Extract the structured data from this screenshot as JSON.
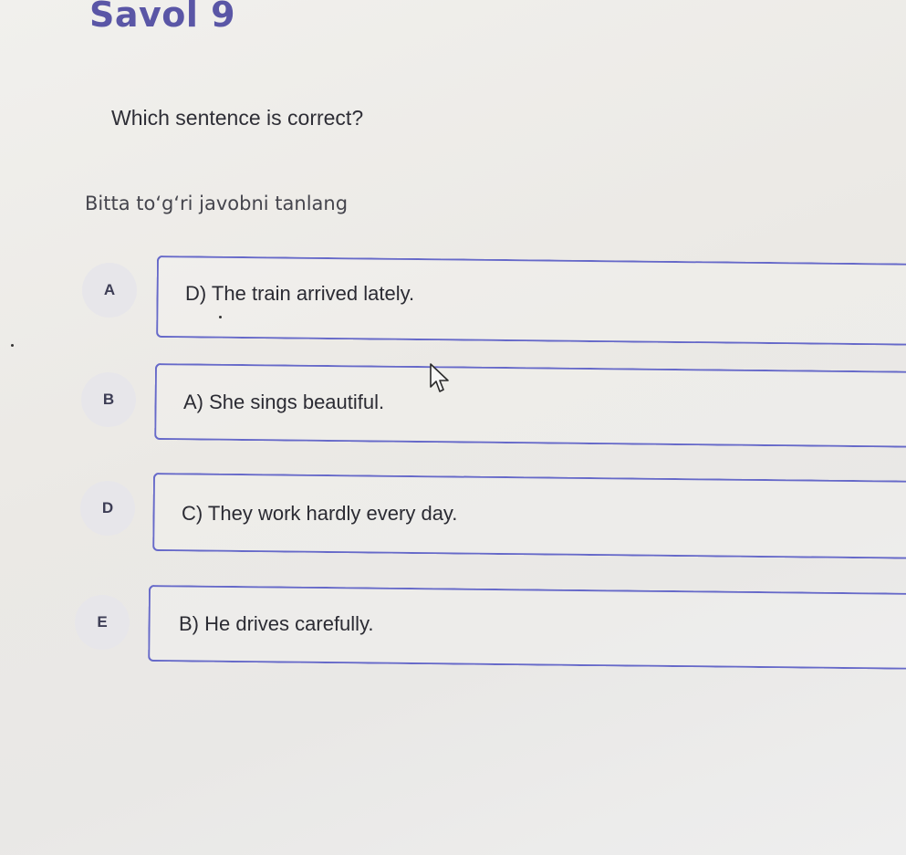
{
  "page": {
    "title": "Savol 9",
    "question": "Which sentence is correct?",
    "instruction": "Bitta to‘g‘ri javobni tanlang"
  },
  "options": [
    {
      "letter": "A",
      "text": "D) The train arrived lately."
    },
    {
      "letter": "B",
      "text": "A) She sings beautiful."
    },
    {
      "letter": "D",
      "text": "C) They work hardly every day."
    },
    {
      "letter": "E",
      "text": "B) He drives carefully."
    }
  ],
  "colors": {
    "title": "#5a56a6",
    "option_border": "#6669c9",
    "letter_badge_bg": "#e7e6ea"
  },
  "icons": {
    "cursor": "mouse-pointer-icon"
  }
}
